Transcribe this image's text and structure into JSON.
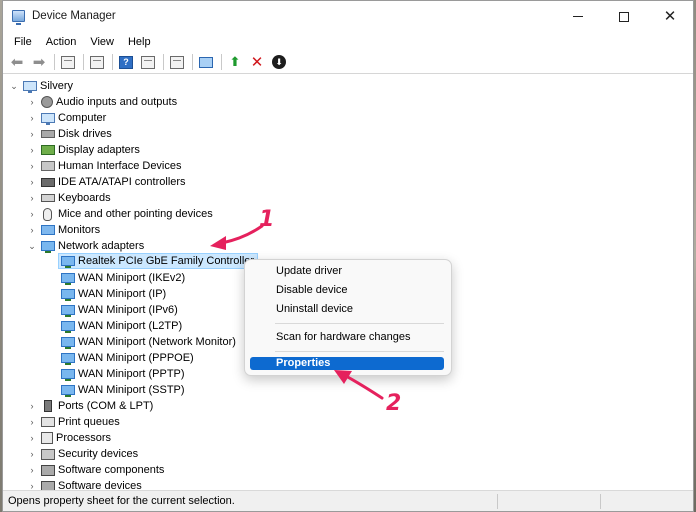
{
  "window": {
    "title": "Device Manager",
    "controls": {
      "minimize": "—",
      "maximize": "☐",
      "close": "✕"
    }
  },
  "menu": [
    "File",
    "Action",
    "View",
    "Help"
  ],
  "toolbar": {
    "help_glyph": "?",
    "delete_glyph": "✕",
    "enable_glyph": "⬆",
    "download_glyph": "⬇"
  },
  "tree": {
    "root": "Silvery",
    "categories": [
      "Audio inputs and outputs",
      "Computer",
      "Disk drives",
      "Display adapters",
      "Human Interface Devices",
      "IDE ATA/ATAPI controllers",
      "Keyboards",
      "Mice and other pointing devices",
      "Monitors",
      "Network adapters"
    ],
    "network_adapters": [
      "Realtek PCIe GbE Family Controller",
      "WAN Miniport (IKEv2)",
      "WAN Miniport (IP)",
      "WAN Miniport (IPv6)",
      "WAN Miniport (L2TP)",
      "WAN Miniport (Network Monitor)",
      "WAN Miniport (PPPOE)",
      "WAN Miniport (PPTP)",
      "WAN Miniport (SSTP)"
    ],
    "more_categories": [
      "Ports (COM & LPT)",
      "Print queues",
      "Processors",
      "Security devices",
      "Software components",
      "Software devices"
    ]
  },
  "context_menu": {
    "update_driver": "Update driver",
    "disable_device": "Disable device",
    "uninstall_device": "Uninstall device",
    "scan": "Scan for hardware changes",
    "properties": "Properties"
  },
  "annotations": {
    "one": "1",
    "two": "2"
  },
  "status": "Opens property sheet for the current selection.",
  "colors": {
    "accent": "#0d6ad0",
    "annotation": "#e5215d",
    "selection": "#cce8ff"
  }
}
